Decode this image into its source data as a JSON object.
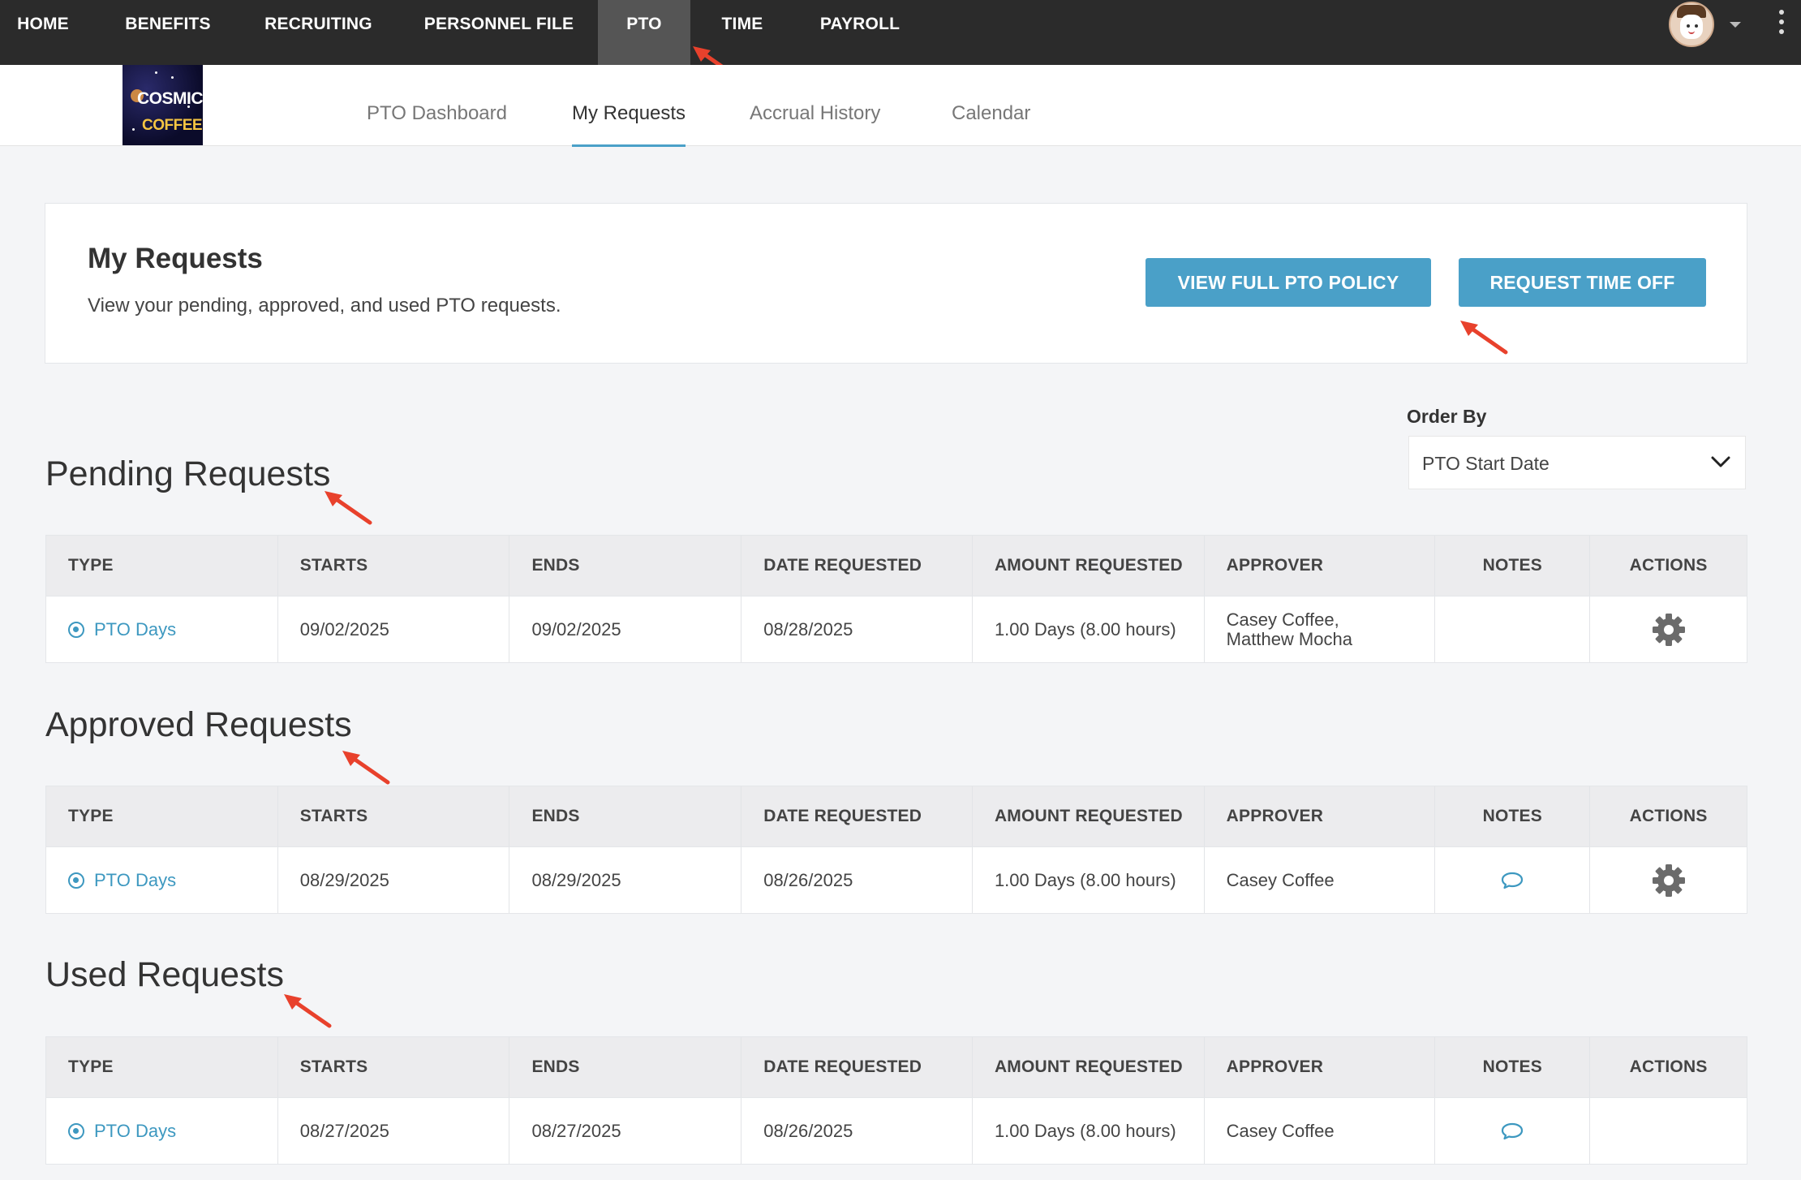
{
  "topnav": {
    "items": [
      {
        "label": "HOME"
      },
      {
        "label": "BENEFITS"
      },
      {
        "label": "RECRUITING"
      },
      {
        "label": "PERSONNEL FILE"
      },
      {
        "label": "PTO"
      },
      {
        "label": "TIME"
      },
      {
        "label": "PAYROLL"
      }
    ],
    "active": "PTO"
  },
  "logo": {
    "line1": "COSMIC",
    "line2": "COFFEE"
  },
  "subnav": {
    "tabs": [
      {
        "label": "PTO Dashboard"
      },
      {
        "label": "My Requests"
      },
      {
        "label": "Accrual History"
      },
      {
        "label": "Calendar"
      }
    ],
    "active": "My Requests"
  },
  "header": {
    "title": "My Requests",
    "subtitle": "View your pending, approved, and used PTO requests.",
    "view_policy_label": "VIEW FULL PTO POLICY",
    "request_time_off_label": "REQUEST TIME OFF"
  },
  "order_by": {
    "label": "Order By",
    "selected": "PTO Start Date"
  },
  "columns": {
    "type": "TYPE",
    "starts": "STARTS",
    "ends": "ENDS",
    "date_requested": "DATE REQUESTED",
    "amount_requested": "AMOUNT REQUESTED",
    "approver": "APPROVER",
    "notes": "NOTES",
    "actions": "ACTIONS"
  },
  "sections": {
    "pending": {
      "title": "Pending Requests",
      "rows": [
        {
          "type": "PTO Days",
          "starts": "09/02/2025",
          "ends": "09/02/2025",
          "date_requested": "08/28/2025",
          "amount": "1.00 Days (8.00 hours)",
          "approver_line1": "Casey Coffee,",
          "approver_line2": "Matthew Mocha"
        }
      ]
    },
    "approved": {
      "title": "Approved Requests",
      "rows": [
        {
          "type": "PTO Days",
          "starts": "08/29/2025",
          "ends": "08/29/2025",
          "date_requested": "08/26/2025",
          "amount": "1.00 Days (8.00 hours)",
          "approver": "Casey Coffee"
        }
      ]
    },
    "used": {
      "title": "Used Requests",
      "rows": [
        {
          "type": "PTO Days",
          "starts": "08/27/2025",
          "ends": "08/27/2025",
          "date_requested": "08/26/2025",
          "amount": "1.00 Days (8.00 hours)",
          "approver": "Casey Coffee"
        }
      ]
    }
  },
  "colors": {
    "nav_bg": "#2b2b2b",
    "nav_active": "#555555",
    "accent": "#4aa0c8",
    "link": "#3d98c0",
    "annotation_arrow": "#e8412c",
    "page_bg": "#f4f5f7"
  },
  "icons": {
    "type_icon": "radio-target-icon",
    "actions_icon": "gear-icon",
    "notes_icon": "comment-icon",
    "select_icon": "chevron-down-icon"
  }
}
